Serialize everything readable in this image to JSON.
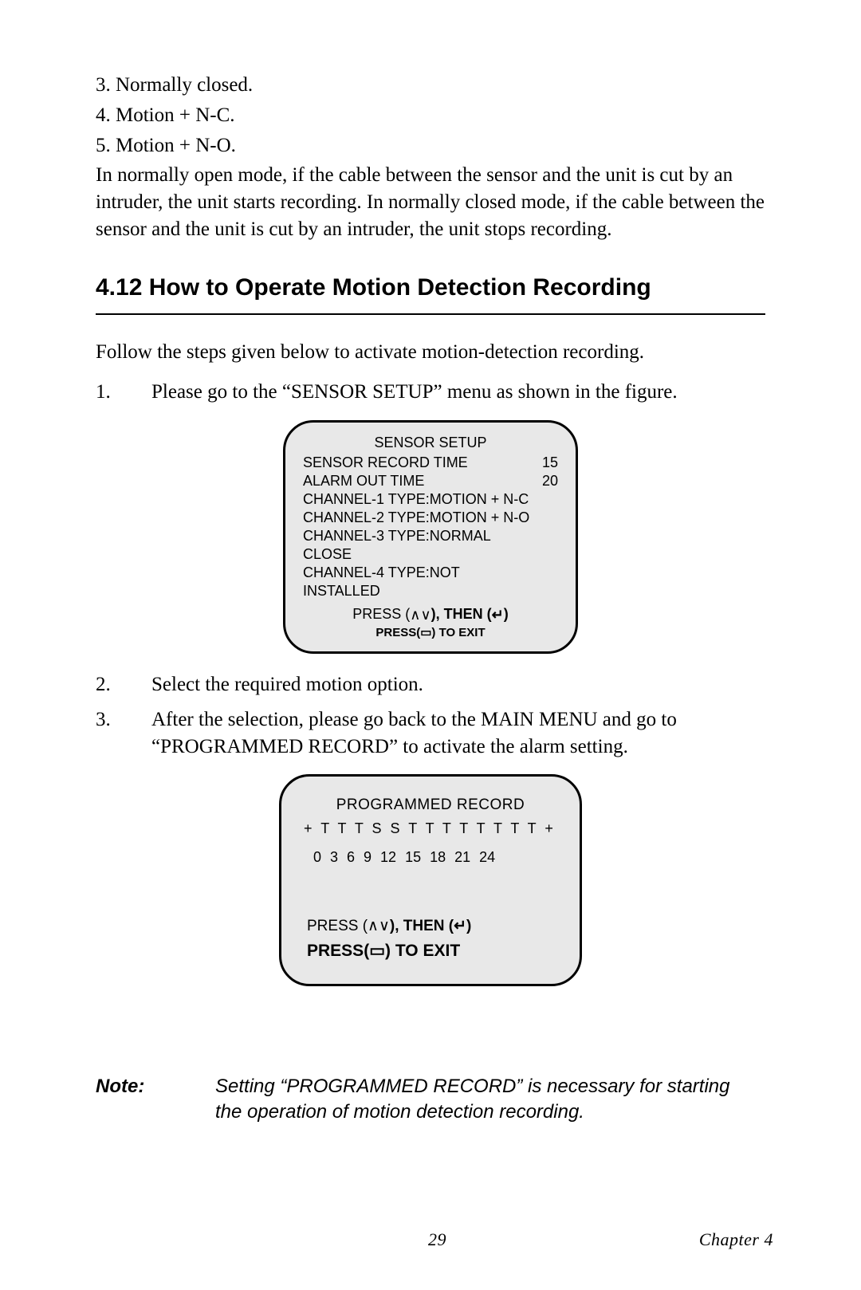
{
  "top_list": {
    "i3": "3. Normally closed.",
    "i4": "4. Motion + N-C.",
    "i5": "5. Motion + N-O."
  },
  "mode_paragraph": "In normally open mode, if the cable between the sensor and the unit is cut by an intruder, the unit starts recording. In normally closed mode, if the cable between the sensor and the unit is cut by an intruder, the unit stops recording.",
  "section": {
    "number_title": "4.12  How to Operate Motion Detection Recording"
  },
  "intro": "Follow the steps given below to activate motion-detection recording.",
  "steps": {
    "s1_num": "1.",
    "s1_txt": "Please go to the “SENSOR SETUP” menu as shown in the figure.",
    "s2_num": "2.",
    "s2_txt": "Select the required motion option.",
    "s3_num": "3.",
    "s3_txt": "After the selection, please go back to the MAIN MENU and go to “PROGRAMMED RECORD” to activate the alarm setting."
  },
  "screen1": {
    "title": "SENSOR SETUP",
    "row1_l": "SENSOR RECORD TIME",
    "row1_r": "15",
    "row2_l": "ALARM OUT TIME",
    "row2_r": "20",
    "l1": "CHANNEL-1   TYPE:MOTION + N-C",
    "l2": "CHANNEL-2   TYPE:MOTION + N-O",
    "l3": "CHANNEL-3   TYPE:NORMAL",
    "l4": "CLOSE",
    "l5": "CHANNEL-4   TYPE:NOT",
    "l6": "INSTALLED",
    "press_a": "PRESS (",
    "press_b": "), THEN (",
    "press_c": ")",
    "exit_a": "PRESS(",
    "exit_b": ") TO EXIT"
  },
  "screen2": {
    "title": "PROGRAMMED RECORD",
    "row": "+ T T T S S T T T T T T T T +",
    "times": "0  3  6  9  12  15  18  21  24",
    "press_a": "PRESS (",
    "press_b": "), THEN (",
    "press_c": ")",
    "exit_a": "PRESS(",
    "exit_b": ") TO EXIT"
  },
  "note": {
    "label": "Note:",
    "text": "Setting “PROGRAMMED RECORD” is necessary for starting the operation of motion detection recording."
  },
  "footer": {
    "page": "29",
    "chapter": "Chapter 4"
  },
  "icons": {
    "up": "∧",
    "down": "∨",
    "enter": "↵",
    "book": "▭"
  }
}
